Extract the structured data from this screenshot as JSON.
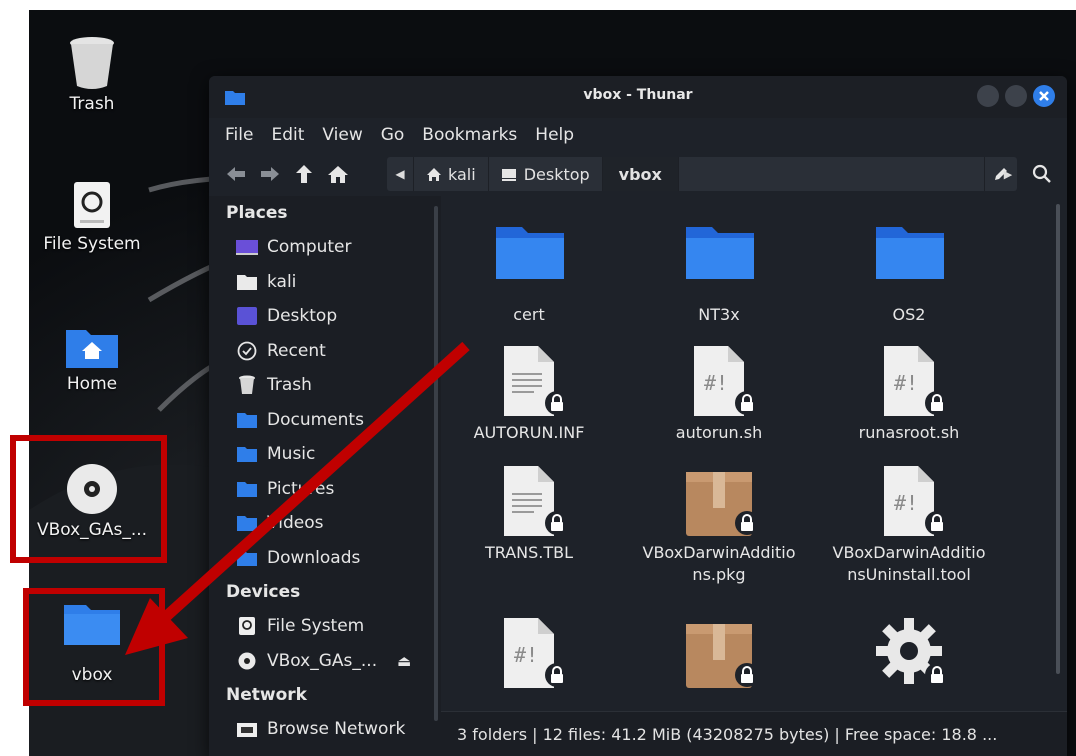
{
  "desktop": {
    "icons": [
      {
        "label": "Trash",
        "icon": "trash-icon"
      },
      {
        "label": "File System",
        "icon": "drive-icon"
      },
      {
        "label": "Home",
        "icon": "home-folder-icon"
      },
      {
        "label": "VBox_GAs_...",
        "icon": "optical-disc-icon"
      },
      {
        "label": "vbox",
        "icon": "folder-icon"
      }
    ]
  },
  "window": {
    "title": "vbox - Thunar",
    "menu": [
      "File",
      "Edit",
      "View",
      "Go",
      "Bookmarks",
      "Help"
    ],
    "breadcrumbs": [
      "kali",
      "Desktop",
      "vbox"
    ],
    "sidebar": {
      "places_header": "Places",
      "places": [
        "Computer",
        "kali",
        "Desktop",
        "Recent",
        "Trash",
        "Documents",
        "Music",
        "Pictures",
        "Videos",
        "Downloads"
      ],
      "devices_header": "Devices",
      "devices": [
        "File System",
        "VBox_GAs_..."
      ],
      "network_header": "Network",
      "network": [
        "Browse Network"
      ]
    },
    "files": [
      {
        "name": "cert",
        "type": "folder"
      },
      {
        "name": "NT3x",
        "type": "folder"
      },
      {
        "name": "OS2",
        "type": "folder"
      },
      {
        "name": "AUTORUN.INF",
        "type": "text"
      },
      {
        "name": "autorun.sh",
        "type": "script"
      },
      {
        "name": "runasroot.sh",
        "type": "script"
      },
      {
        "name": "TRANS.TBL",
        "type": "text"
      },
      {
        "name": "VBoxDarwinAdditio ns.pkg",
        "type": "package"
      },
      {
        "name": "VBoxDarwinAdditio nsUninstall.tool",
        "type": "script"
      },
      {
        "name": "",
        "type": "script"
      },
      {
        "name": "",
        "type": "package"
      },
      {
        "name": "",
        "type": "executable"
      }
    ],
    "status": "3 folders | 12 files: 41.2 MiB (43208275 bytes) | Free space: 18.8 ..."
  },
  "colors": {
    "annotation": "#c00000",
    "folder": "#2f7ee9",
    "close_button": "#2f7ee9"
  }
}
